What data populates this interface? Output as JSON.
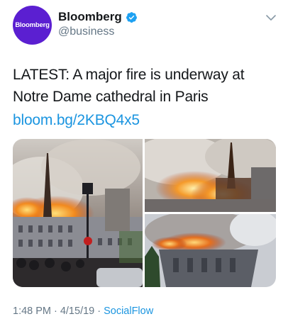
{
  "user": {
    "avatar_text": "Bloomberg",
    "display_name": "Bloomberg",
    "handle": "@business",
    "verified": true,
    "avatar_color": "#5b1fd1"
  },
  "tweet": {
    "text": "LATEST: A major fire is underway at Notre Dame cathedral in Paris",
    "link": "bloom.bg/2KBQ4x5",
    "time": "1:48 PM",
    "date": "4/15/19",
    "separator": "·",
    "source": "SocialFlow"
  },
  "media": {
    "photos": [
      {
        "name": "notre-dame-fire-street-view"
      },
      {
        "name": "notre-dame-spire-fire"
      },
      {
        "name": "notre-dame-roof-fire"
      }
    ]
  },
  "icons": {
    "verified": "verified-badge-icon",
    "menu": "chevron-down-icon"
  },
  "colors": {
    "link": "#1b95e0",
    "secondary_text": "#657786",
    "primary_text": "#14171a",
    "verified": "#1da1f2"
  }
}
